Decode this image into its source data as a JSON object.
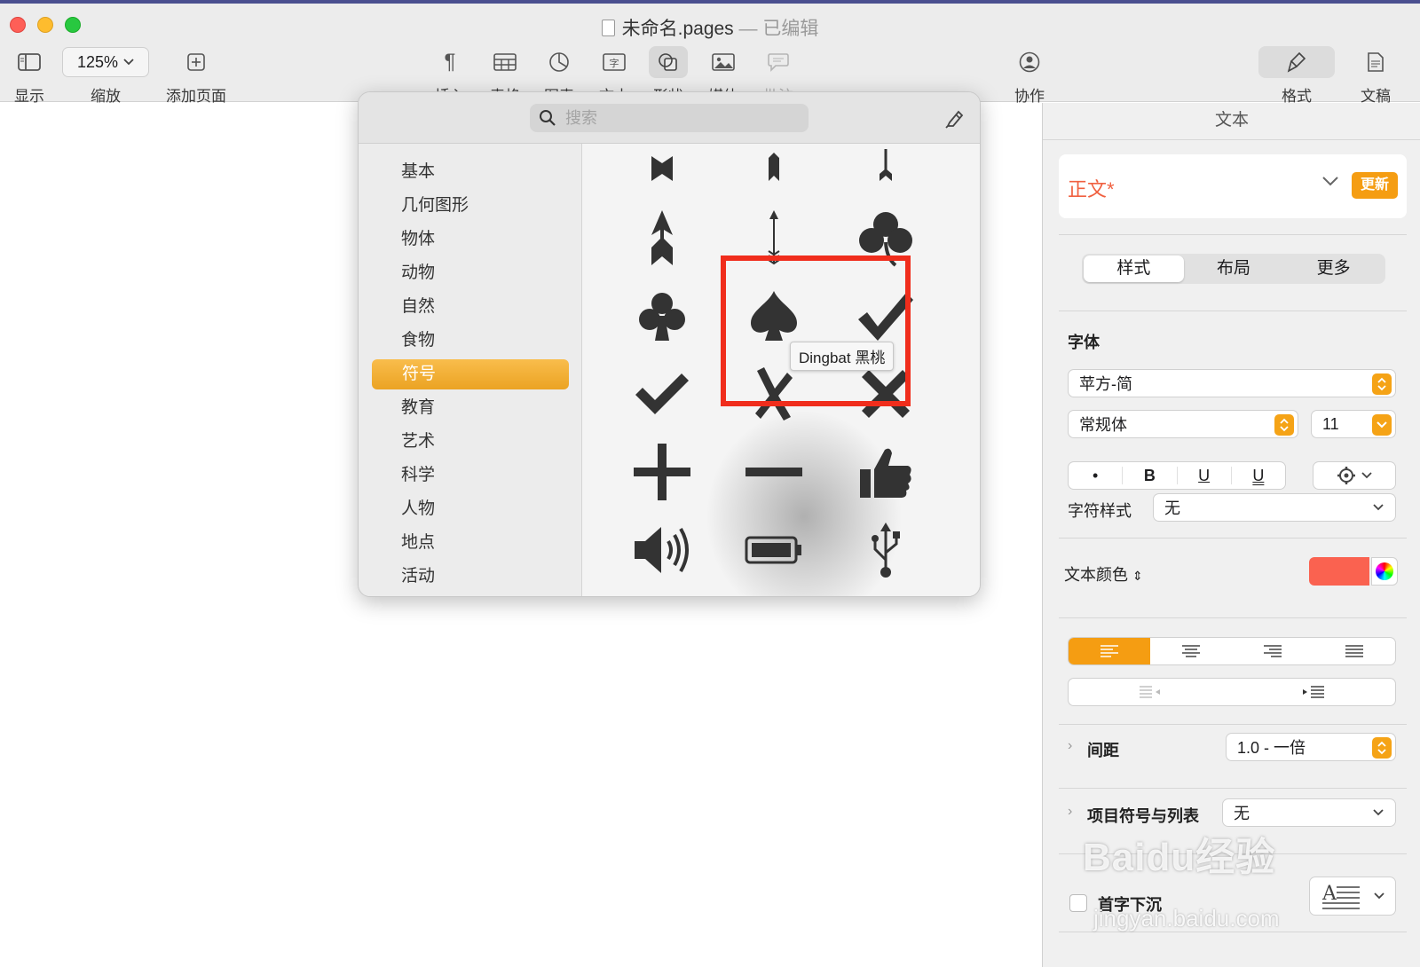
{
  "window": {
    "title": "未命名.pages",
    "dash": "—",
    "edited": "已编辑"
  },
  "toolbar": {
    "view": "显示",
    "zoom_value": "125%",
    "zoom_label": "缩放",
    "add_page": "添加页面",
    "insert": "插入",
    "table": "表格",
    "chart": "图表",
    "text": "文本",
    "shape": "形状",
    "media": "媒体",
    "comment": "批注",
    "collaborate": "协作",
    "format": "格式",
    "document": "文稿"
  },
  "shape_popover": {
    "search_placeholder": "搜索",
    "categories": [
      "基本",
      "几何图形",
      "物体",
      "动物",
      "自然",
      "食物",
      "符号",
      "教育",
      "艺术",
      "科学",
      "人物",
      "地点",
      "活动"
    ],
    "selected_category": "符号",
    "tooltip": "Dingbat 黑桃"
  },
  "sidebar": {
    "header": "文本",
    "paragraph_style": "正文*",
    "update_button": "更新",
    "tabs": [
      "样式",
      "布局",
      "更多"
    ],
    "active_tab": "样式",
    "font_section": "字体",
    "font_family": "苹方-简",
    "font_weight": "常规体",
    "font_size": "11",
    "format_buttons": [
      "•",
      "B",
      "U",
      "U"
    ],
    "char_style_label": "字符样式",
    "char_style_value": "无",
    "text_color_label": "文本颜色",
    "text_color": "#fa6250",
    "spacing_label": "间距",
    "spacing_value": "1.0 - 一倍",
    "bullets_label": "项目符号与列表",
    "bullets_value": "无",
    "dropcap_label": "首字下沉"
  },
  "watermark": {
    "main": "Baidu经验",
    "sub": "jingyan.baidu.com"
  },
  "accent": "#f59d12"
}
